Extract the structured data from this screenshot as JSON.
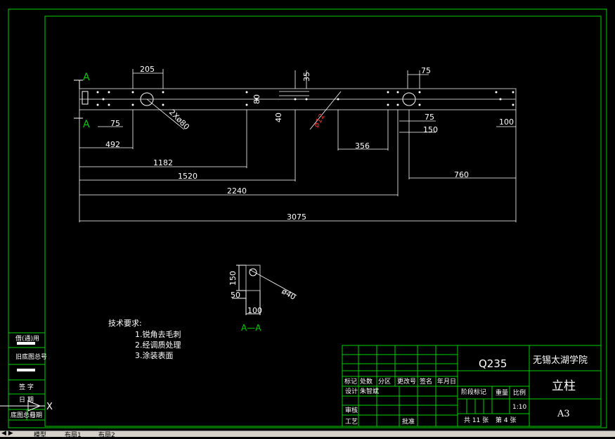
{
  "drawing": {
    "dims": {
      "d205": "205",
      "d35": "35",
      "d75a": "75",
      "d80": "80",
      "d40": "40",
      "d12": "ø12",
      "d75b": "75",
      "d150": "150",
      "d100": "100",
      "d75c": "75",
      "hole": "2Xø80",
      "d492": "492",
      "d356": "356",
      "d1182": "1182",
      "d1520": "1520",
      "d760": "760",
      "d2240": "2240",
      "d3075": "3075"
    },
    "section_mark_top": "A",
    "section_mark_bottom": "A",
    "section": {
      "d150": "150",
      "d50": "50",
      "d100": "100",
      "d40": "ø40",
      "label": "A—A"
    },
    "tech": {
      "title": "技术要求:",
      "items": [
        "1.锐角去毛刺",
        "2.经调质处理",
        "3.涂装表面"
      ]
    }
  },
  "title_block": {
    "material": "Q235",
    "school": "无锡太湖学院",
    "part_name": "立柱",
    "paper": "A3",
    "scale": "1:10",
    "sheet_total": "共 11 张",
    "sheet_no": "第 4 张",
    "row_labels": [
      "标记",
      "处数",
      "分区",
      "更改号",
      "签名",
      "年月日"
    ],
    "design": "设计",
    "designer": "朱智斌",
    "check": "审核",
    "process": "工艺",
    "approve": "批准",
    "stage": "阶段标记",
    "weight": "重量",
    "ratio": "比例"
  },
  "left_strip": [
    "借(通)用",
    "旧底图总号",
    "签 字",
    "日 期",
    "底图总号",
    "日期"
  ],
  "axis_label": "X",
  "tabs": [
    "模型",
    "布局1",
    "布局2"
  ]
}
